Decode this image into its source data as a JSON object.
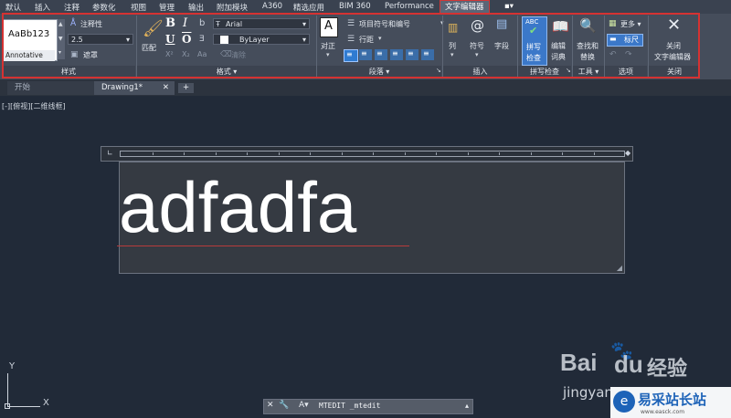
{
  "menubar": {
    "items": [
      "默认",
      "插入",
      "注释",
      "参数化",
      "视图",
      "管理",
      "输出",
      "附加模块",
      "A360",
      "精选应用",
      "BIM 360",
      "Performance",
      "文字编辑器"
    ],
    "active_index": 12,
    "extra": "▪▾"
  },
  "ribbon": {
    "style": {
      "preview": "AaBb123",
      "annotative": "Annotative",
      "annotative_toggle": "注释性",
      "text_height": "2.5",
      "mask": "遮罩",
      "footer": "样式"
    },
    "format": {
      "match": "匹配",
      "bold": "B",
      "italic": "I",
      "underline": "U",
      "overline": "O",
      "strike": "b",
      "superscript": "X²",
      "subscript": "X₂",
      "case": "Aa",
      "font": "Arial",
      "color": "ByLayer",
      "clear": "清除",
      "footer": "格式 ▾"
    },
    "paragraph": {
      "justify": "对正",
      "bullets": "项目符号和编号",
      "line_spacing": "行距",
      "footer": "段落 ▾"
    },
    "insert": {
      "columns": "列",
      "symbol": "符号",
      "field": "字段",
      "footer": "插入"
    },
    "spell": {
      "check_line1": "拼写",
      "check_line2": "检查",
      "dict_line1": "编辑",
      "dict_line2": "词典",
      "footer": "拼写检查"
    },
    "tools": {
      "find_line1": "查找和",
      "find_line2": "替换",
      "footer": "工具 ▾"
    },
    "options": {
      "more": "更多 ▾",
      "ruler": "标尺",
      "footer": "选项"
    },
    "close": {
      "line1": "关闭",
      "line2": "文字编辑器",
      "footer": "关闭"
    }
  },
  "tabs": {
    "start": "开始",
    "drawing": "Drawing1*",
    "add": "+"
  },
  "viewport": {
    "label": "[-][俯视][二维线框]",
    "text": "adfadfa",
    "axis_y": "Y",
    "axis_x": "X"
  },
  "command": {
    "text": "MTEDIT _mtedit"
  },
  "watermark": {
    "baidu": "Bai",
    "du": "du",
    "jingyan": "经验",
    "url": "jingyan",
    "site": "易采站长站",
    "site_url": "www.easck.com"
  }
}
